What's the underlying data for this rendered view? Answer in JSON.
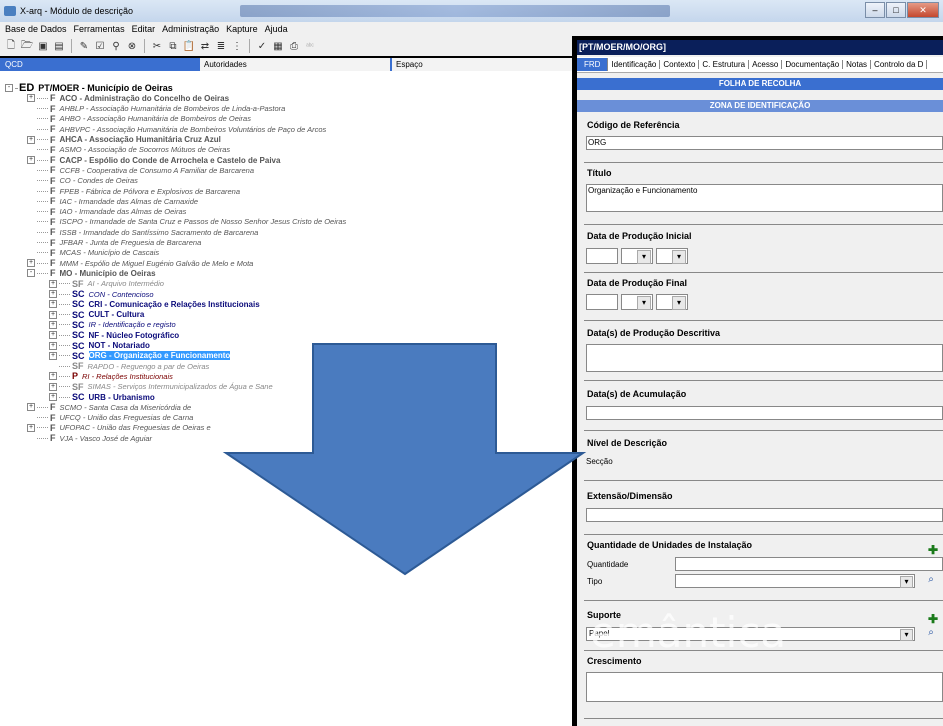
{
  "window": {
    "title": "X-arq - Módulo de descrição"
  },
  "menu": [
    "Base de Dados",
    "Ferramentas",
    "Editar",
    "Administração",
    "Kapture",
    "Ajuda"
  ],
  "toolbar_icons": [
    "new-icon",
    "open-icon",
    "save-icon",
    "save-all-icon",
    "edit-icon",
    "check-icon",
    "search-icon",
    "filter-icon",
    "cut-icon",
    "copy-icon",
    "paste-icon",
    "link-icon",
    "tree-icon",
    "spell-icon",
    "document-icon",
    "print-icon",
    "abc-icon"
  ],
  "left_columns": {
    "c1": "QCD",
    "c2": "Autoridades",
    "c3": "Espaço"
  },
  "tree": [
    {
      "lvl": "ED",
      "label": "PT/MOER - Município de Oeiras",
      "style": "root",
      "exp": "-"
    },
    {
      "lvl": "F",
      "label": "ACO - Administração do Concelho de Oeiras",
      "style": "gray",
      "exp": "+"
    },
    {
      "lvl": "F",
      "label": "AHBLP - Associação Humanitária de Bombeiros de Linda-a-Pastora",
      "style": "it",
      "exp": ""
    },
    {
      "lvl": "F",
      "label": "AHBO - Associação Humanitária de Bombeiros de Oeiras",
      "style": "it",
      "exp": ""
    },
    {
      "lvl": "F",
      "label": "AHBVPC - Associação Humanitária de Bombeiros Voluntários de Paço de Arcos",
      "style": "it",
      "exp": ""
    },
    {
      "lvl": "F",
      "label": "AHCA - Associação Humanitária Cruz Azul",
      "style": "bold",
      "exp": "+"
    },
    {
      "lvl": "F",
      "label": "ASMO - Associação de Socorros Mútuos de Oeiras",
      "style": "it",
      "exp": ""
    },
    {
      "lvl": "F",
      "label": "CACP - Espólio do Conde de Arrochela e Castelo de Paiva",
      "style": "bold",
      "exp": "+"
    },
    {
      "lvl": "F",
      "label": "CCFB - Cooperativa de Consumo A Familiar de Barcarena",
      "style": "it",
      "exp": ""
    },
    {
      "lvl": "F",
      "label": "CO - Condes de Oeiras",
      "style": "it",
      "exp": ""
    },
    {
      "lvl": "F",
      "label": "FPEB - Fábrica de Pólvora e Explosivos de Barcarena",
      "style": "it",
      "exp": ""
    },
    {
      "lvl": "F",
      "label": "IAC - Irmandade das Almas de Carnaxide",
      "style": "it",
      "exp": ""
    },
    {
      "lvl": "F",
      "label": "IAO - Irmandade das Almas de Oeiras",
      "style": "it",
      "exp": ""
    },
    {
      "lvl": "F",
      "label": "ISCPO - Irmandade de Santa Cruz e Passos de Nosso Senhor Jesus Cristo de Oeiras",
      "style": "it",
      "exp": ""
    },
    {
      "lvl": "F",
      "label": "ISSB - Irmandade do Santíssimo Sacramento de Barcarena",
      "style": "it",
      "exp": ""
    },
    {
      "lvl": "F",
      "label": "JFBAR - Junta de Freguesia de Barcarena",
      "style": "it",
      "exp": ""
    },
    {
      "lvl": "F",
      "label": "MCAS - Município de Cascais",
      "style": "it",
      "exp": ""
    },
    {
      "lvl": "F",
      "label": "MMM - Espólio de Miguel Eugénio Galvão de Melo e Mota",
      "style": "it",
      "exp": "+"
    },
    {
      "lvl": "F",
      "label": "MO - Município de Oeiras",
      "style": "gray",
      "exp": "-"
    },
    {
      "lvl": "SF",
      "label": "AI - Arquivo Intermédio",
      "style": "sub-it",
      "exp": "+"
    },
    {
      "lvl": "SC",
      "label": "CON - Contencioso",
      "style": "navy-it",
      "exp": "+"
    },
    {
      "lvl": "SC",
      "label": "CRI - Comunicação e Relações Institucionais",
      "style": "navy",
      "exp": "+"
    },
    {
      "lvl": "SC",
      "label": "CULT - Cultura",
      "style": "navy",
      "exp": "+"
    },
    {
      "lvl": "SC",
      "label": "IR - Identificação e registo",
      "style": "navy-it",
      "exp": "+"
    },
    {
      "lvl": "SC",
      "label": "NF - Núcleo Fotográfico",
      "style": "navy",
      "exp": "+"
    },
    {
      "lvl": "SC",
      "label": "NOT - Notariado",
      "style": "navy",
      "exp": "+"
    },
    {
      "lvl": "SC",
      "label": "ORG - Organização e Funcionamento",
      "style": "selected",
      "exp": "+"
    },
    {
      "lvl": "SF",
      "label": "RAPDO - Reguengo a par de Oeiras",
      "style": "sub-it",
      "exp": ""
    },
    {
      "lvl": "P",
      "label": "RI - Relações Institucionais",
      "style": "maroon",
      "exp": "+"
    },
    {
      "lvl": "SF",
      "label": "SIMAS - Serviços Intermunicipalizados de Água e Sane",
      "style": "sub-it",
      "exp": "+"
    },
    {
      "lvl": "SC",
      "label": "URB - Urbanismo",
      "style": "navy",
      "exp": "+"
    },
    {
      "lvl": "F",
      "label": "SCMO - Santa Casa da Misericórdia de",
      "style": "it",
      "exp": "+"
    },
    {
      "lvl": "F",
      "label": "UFCQ - União das Freguesias de Carna",
      "style": "it",
      "exp": ""
    },
    {
      "lvl": "F",
      "label": "UFOPAC - União das Freguesias de Oeiras e",
      "style": "it",
      "exp": "+"
    },
    {
      "lvl": "F",
      "label": "VJA - Vasco José de Aguiar",
      "style": "it",
      "exp": ""
    }
  ],
  "right": {
    "title": "[PT/MOER/MO/ORG]",
    "tabs": [
      "FRD",
      "Identificação",
      "Contexto",
      "C. Estrutura",
      "Acesso",
      "Documentação",
      "Notas",
      "Controlo da D"
    ],
    "banner1": "FOLHA DE RECOLHA",
    "banner2": "ZONA DE IDENTIFICAÇÃO",
    "f_codigo": "Código de Referência",
    "v_codigo": "ORG",
    "f_titulo": "Título",
    "v_titulo": "Organização e Funcionamento",
    "f_data_ini": "Data de Produção Inicial",
    "f_data_fim": "Data de Produção Final",
    "f_data_desc": "Data(s) de Produção Descritiva",
    "f_data_acum": "Data(s) de Acumulação",
    "f_nivel": "Nível de Descrição",
    "v_nivel": "Secção",
    "f_extensao": "Extensão/Dimensão",
    "f_quant": "Quantidade de Unidades de Instalação",
    "l_quantidade": "Quantidade",
    "l_tipo": "Tipo",
    "f_suporte": "Suporte",
    "v_suporte": "Papel",
    "f_crescimento": "Crescimento"
  },
  "overlay_text": "emântica"
}
